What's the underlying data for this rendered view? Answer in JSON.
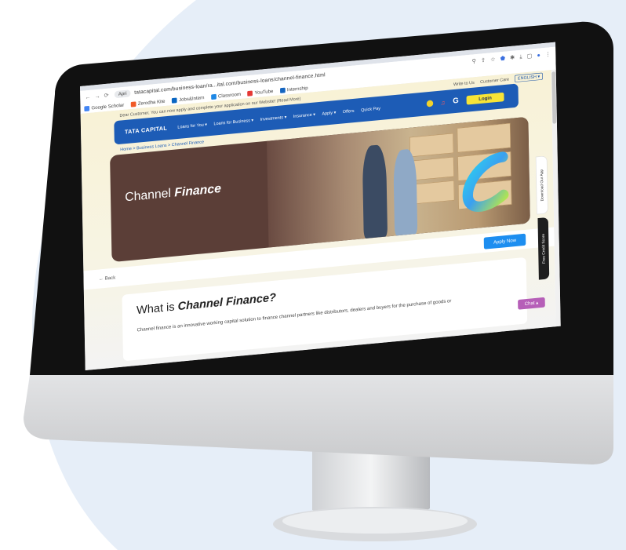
{
  "browser": {
    "site_chip": "Apri",
    "url": "tatacapital.com/business-loan/ra...ital.com/business-loans/channel-finance.html",
    "bookmarks": [
      "Google Scholar",
      "Zerodha Kite",
      "Jobs&Intern",
      "Classroom",
      "YouTube",
      "Internship"
    ]
  },
  "topline": {
    "message": "Dear Customer, You can now apply and complete your application on our Website! (Read More)",
    "phone1": "Write to Us",
    "phone2": "Customer Care",
    "lang": "ENGLISH ▾"
  },
  "nav": {
    "brand": "TATA CAPITAL",
    "menu": [
      "Loans for You ▾",
      "Loans for Business ▾",
      "Investments ▾",
      "Insurance ▾",
      "Apply ▾",
      "Offers",
      "Quick Pay"
    ],
    "login": "Login"
  },
  "breadcrumb": "Home > Business Loans > Channel Finance",
  "hero": {
    "title_light": "Channel ",
    "title_bold": "Finance"
  },
  "action_bar": {
    "back": "← Back",
    "apply": "Apply Now"
  },
  "card": {
    "heading_light": "What is ",
    "heading_bold": "Channel Finance?",
    "body": "Channel finance is an innovative working capital solution to finance channel partners like distributors, dealers and buyers for the purchase of goods or"
  },
  "side": {
    "download": "Download Our App",
    "credit": "Free Credit Score"
  },
  "chat": "Chat ▴",
  "colors": {
    "nav_blue": "#1d5cb6",
    "login_yellow": "#f7e437",
    "hero_brown": "#5b3e37",
    "apply_blue": "#1d8ef0",
    "chat_purple": "#b65fb8"
  }
}
